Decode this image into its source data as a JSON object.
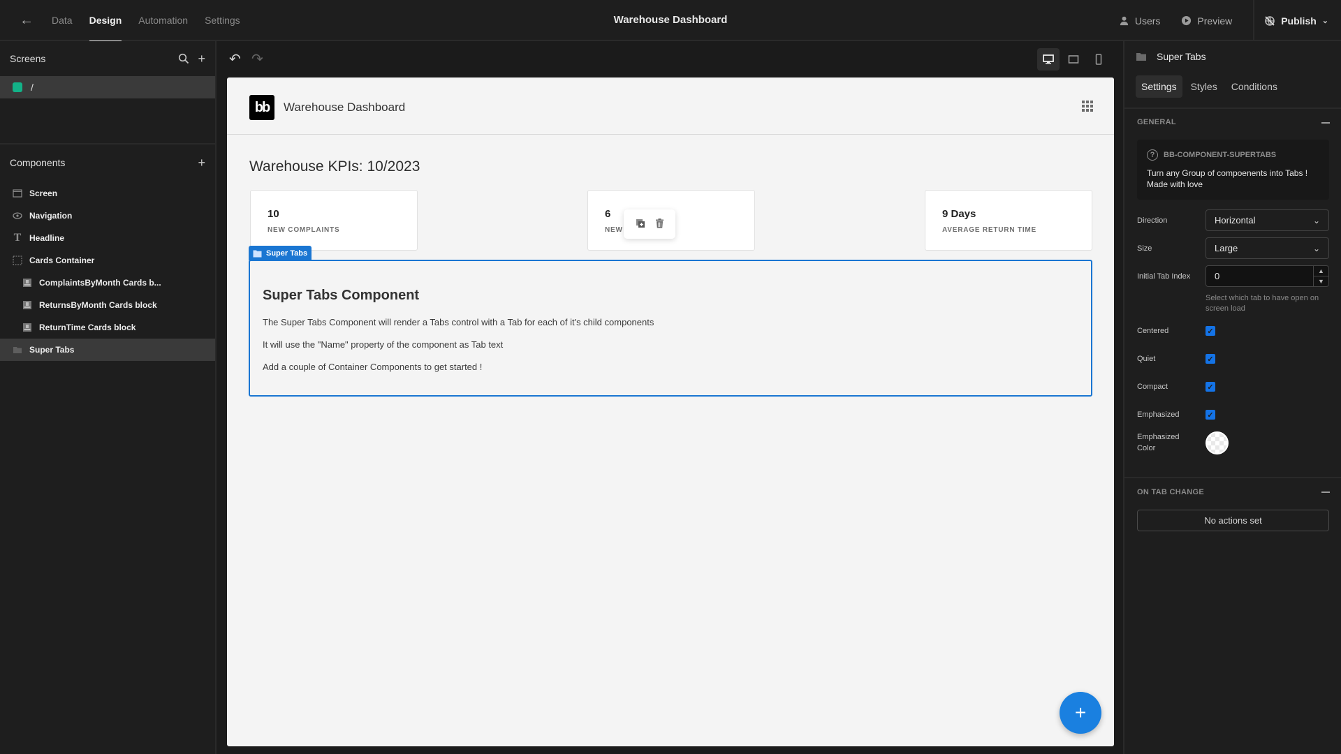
{
  "topbar": {
    "nav_tabs": [
      "Data",
      "Design",
      "Automation",
      "Settings"
    ],
    "active_tab": "Design",
    "app_title": "Warehouse Dashboard",
    "users_label": "Users",
    "preview_label": "Preview",
    "publish_label": "Publish"
  },
  "left_panel": {
    "screens_title": "Screens",
    "screens": [
      {
        "route": "/",
        "color": "#13b288"
      }
    ],
    "components_title": "Components",
    "components": [
      {
        "label": "Screen",
        "icon": "screen-icon",
        "depth": 0
      },
      {
        "label": "Navigation",
        "icon": "eye-icon",
        "depth": 0
      },
      {
        "label": "Headline",
        "icon": "text-icon",
        "depth": 0
      },
      {
        "label": "Cards Container",
        "icon": "container-icon",
        "depth": 0
      },
      {
        "label": "ComplaintsByMonth Cards b...",
        "icon": "cards-block-icon",
        "depth": 1
      },
      {
        "label": "ReturnsByMonth Cards block",
        "icon": "cards-block-icon",
        "depth": 1
      },
      {
        "label": "ReturnTime Cards block",
        "icon": "cards-block-icon",
        "depth": 1
      },
      {
        "label": "Super Tabs",
        "icon": "folder-icon",
        "depth": 0,
        "selected": true
      }
    ]
  },
  "canvas": {
    "app_name": "Warehouse Dashboard",
    "logo_text": "bb",
    "kpi_title": "Warehouse KPIs: 10/2023",
    "cards": [
      {
        "value": "10",
        "label": "NEW COMPLAINTS"
      },
      {
        "value": "6",
        "label": "NEW RETURNS"
      },
      {
        "value": "9 Days",
        "label": "AVERAGE RETURN TIME"
      }
    ],
    "selected_tag": "Super Tabs",
    "super_tabs": {
      "title": "Super Tabs Component",
      "lines": [
        "The Super Tabs Component will render a Tabs control with a Tab for each of it's child components",
        "It will use the \"Name\" property of the component as Tab text",
        "Add a couple of Container Components to get started !"
      ]
    }
  },
  "right_panel": {
    "component_name": "Super Tabs",
    "tabs": [
      "Settings",
      "Styles",
      "Conditions"
    ],
    "active_tab": "Settings",
    "general_title": "GENERAL",
    "info_title": "BB-COMPONENT-SUPERTABS",
    "info_text": "Turn any Group of compoenents into Tabs ! Made with love",
    "direction_label": "Direction",
    "direction_value": "Horizontal",
    "size_label": "Size",
    "size_value": "Large",
    "initial_tab_label": "Initial Tab Index",
    "initial_tab_value": "0",
    "initial_tab_help": "Select which tab to have open on screen load",
    "checkboxes": [
      {
        "label": "Centered",
        "checked": true
      },
      {
        "label": "Quiet",
        "checked": true
      },
      {
        "label": "Compact",
        "checked": true
      },
      {
        "label": "Emphasized",
        "checked": true
      }
    ],
    "emphasized_color_label": "Emphasized Color",
    "on_tab_change_title": "ON TAB CHANGE",
    "no_actions_label": "No actions set"
  },
  "colors": {
    "accent": "#1a76d2",
    "checkbox": "#1473e6",
    "fab": "#1a80e0"
  }
}
